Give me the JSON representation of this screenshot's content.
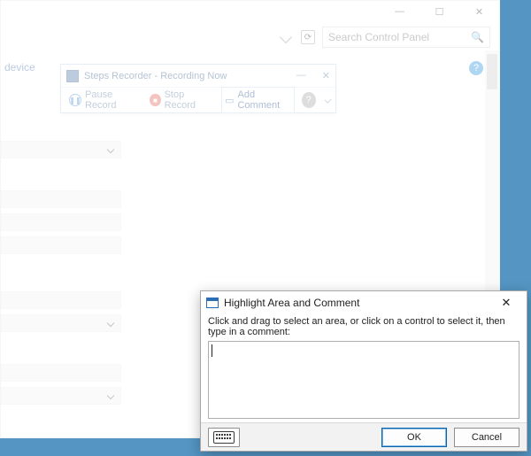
{
  "control_panel": {
    "search_placeholder": "Search Control Panel",
    "side_text": "device"
  },
  "steps_recorder": {
    "title": "Steps Recorder - Recording Now",
    "pause": "Pause Record",
    "stop": "Stop Record",
    "add_comment": "Add Comment"
  },
  "dialog": {
    "title": "Highlight Area and Comment",
    "instruction": "Click and drag to select an area, or click on a control to select it, then type in a comment:",
    "ok": "OK",
    "cancel": "Cancel"
  }
}
